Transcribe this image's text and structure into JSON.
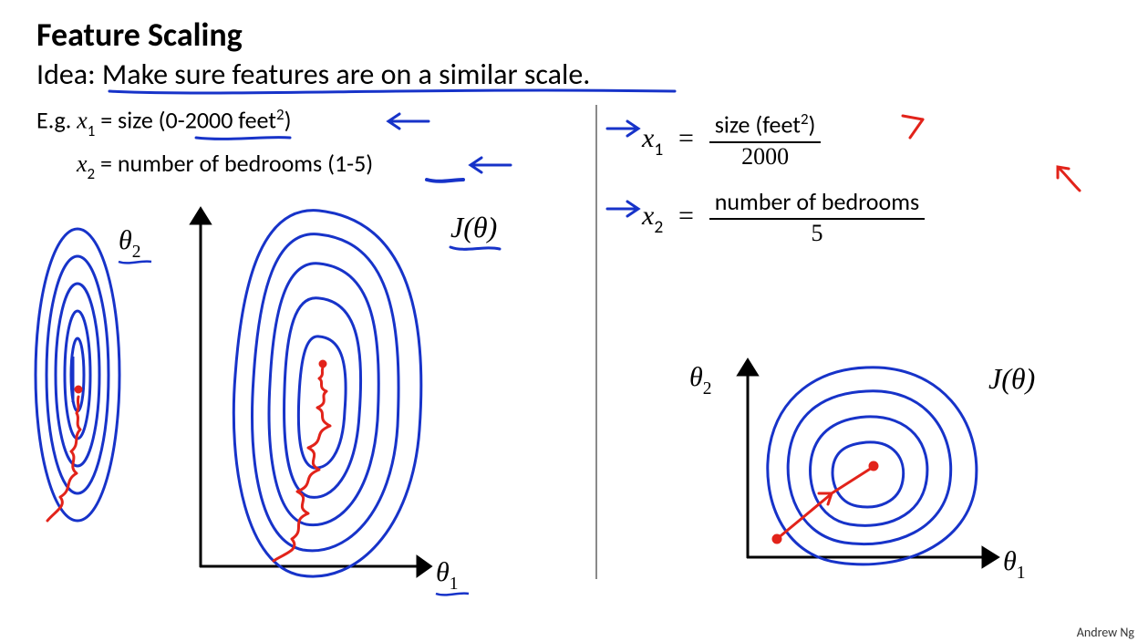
{
  "title": "Feature Scaling",
  "idea_prefix": "Idea: ",
  "idea_main": "Make sure features are on a similar scale.",
  "left": {
    "eg_prefix": "E.g. ",
    "x1_var": "x",
    "x1_sub": "1",
    "x1_eq": " = size (0-2000 feet",
    "x1_sup": "2",
    "x1_close": ")",
    "x2_var": "x",
    "x2_sub": "2",
    "x2_text": " = number of bedrooms (1-5)",
    "J_label": "J(θ)",
    "theta1": "θ",
    "theta1_sub": "1",
    "theta2": "θ",
    "theta2_sub": "2"
  },
  "right": {
    "x1_var": "x",
    "x1_sub": "1",
    "x1_eq": " = ",
    "x1_num_a": "size (feet",
    "x1_num_sup": "2",
    "x1_num_b": ")",
    "x1_den": "2000",
    "x2_var": "x",
    "x2_sub": "2",
    "x2_eq": " = ",
    "x2_num": "number of bedrooms",
    "x2_den": "5",
    "J_label": "J(θ)",
    "theta1": "θ",
    "theta1_sub": "1",
    "theta2": "θ",
    "theta2_sub": "2"
  },
  "attribution": "Andrew Ng",
  "colors": {
    "pen_blue": "#1733c9",
    "pen_red": "#e2231a",
    "divider": "#8a8a8a"
  }
}
